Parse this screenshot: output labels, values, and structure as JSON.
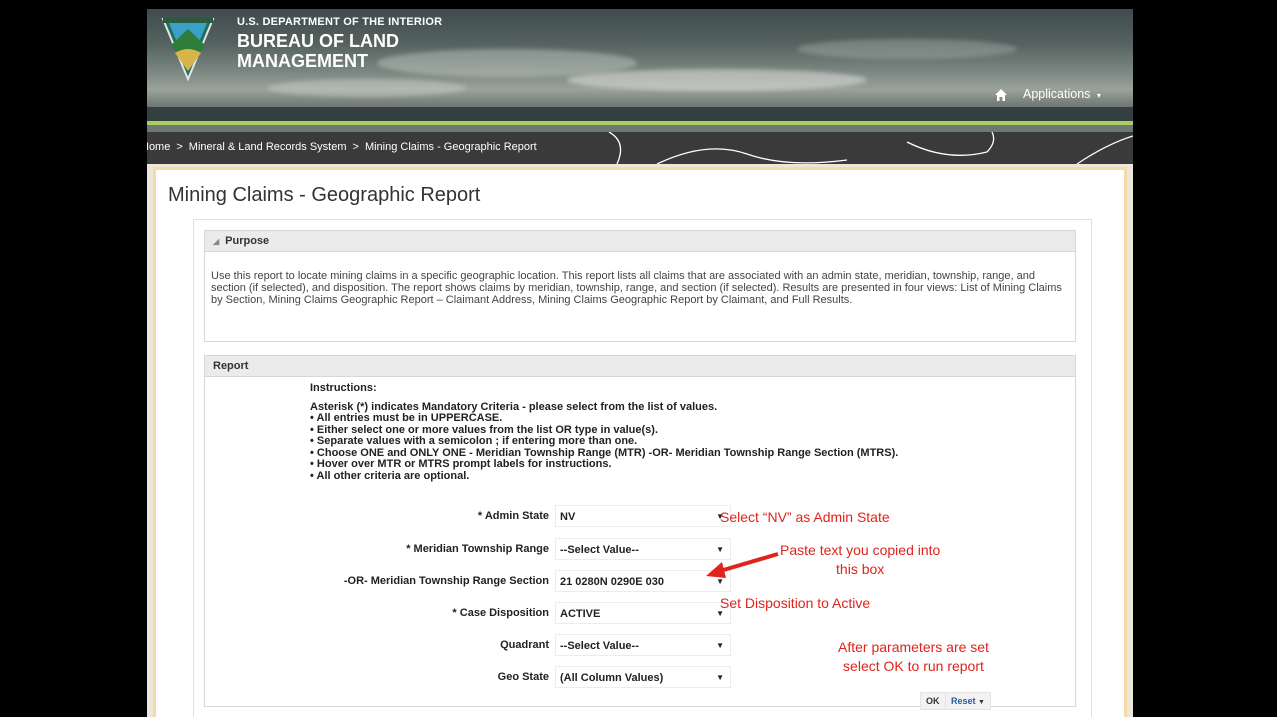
{
  "header": {
    "agency_line1": "U.S. DEPARTMENT OF THE INTERIOR",
    "agency_line2": "BUREAU OF LAND MANAGEMENT",
    "applications_label": "Applications",
    "home_icon": "home-icon",
    "green_accent": "#a9cf63"
  },
  "breadcrumb": {
    "items": [
      "Home",
      "Mineral & Land Records System",
      "Mining Claims - Geographic Report"
    ],
    "separator": ">"
  },
  "page": {
    "title": "Mining Claims - Geographic Report"
  },
  "purpose": {
    "heading": "Purpose",
    "text": "Use this report to locate mining claims in a specific geographic location. This report lists all claims that are associated with an admin state, meridian, township, range, and section (if selected), and disposition. The report shows claims by meridian, township, range, and section (if selected). Results are presented in four views: List of Mining Claims by Section, Mining Claims Geographic Report – Claimant Address, Mining Claims Geographic Report by Claimant, and Full Results."
  },
  "report": {
    "heading": "Report",
    "instructions_title": "Instructions:",
    "instructions": [
      "Asterisk (*) indicates Mandatory Criteria - please select from the list of values.",
      "• All entries must be in UPPERCASE.",
      "• Either select one or more values from the list OR type in value(s).",
      "• Separate values with a semicolon ; if entering more than one.",
      "• Choose ONE and ONLY ONE - Meridian Township Range (MTR) -OR- Meridian Township Range Section (MTRS).",
      "• Hover over MTR or MTRS prompt labels for instructions.",
      "• All other criteria are optional."
    ],
    "fields": [
      {
        "label": "* Admin State",
        "value": "NV"
      },
      {
        "label": "* Meridian Township Range",
        "value": "--Select Value--"
      },
      {
        "label": "-OR- Meridian Township Range Section",
        "value": "21 0280N 0290E 030"
      },
      {
        "label": "* Case Disposition",
        "value": "ACTIVE"
      },
      {
        "label": "Quadrant",
        "value": "--Select Value--"
      },
      {
        "label": "Geo State",
        "value": "(All Column Values)"
      }
    ],
    "ok_label": "OK",
    "reset_label": "Reset"
  },
  "annotations": {
    "admin_state": "Select “NV” as Admin State",
    "paste_line1": "Paste text you copied into",
    "paste_line2": "this box",
    "disposition": "Set Disposition to Active",
    "ok_line1": "After  parameters are set",
    "ok_line2": "select OK to run report",
    "color": "#e0231b"
  }
}
